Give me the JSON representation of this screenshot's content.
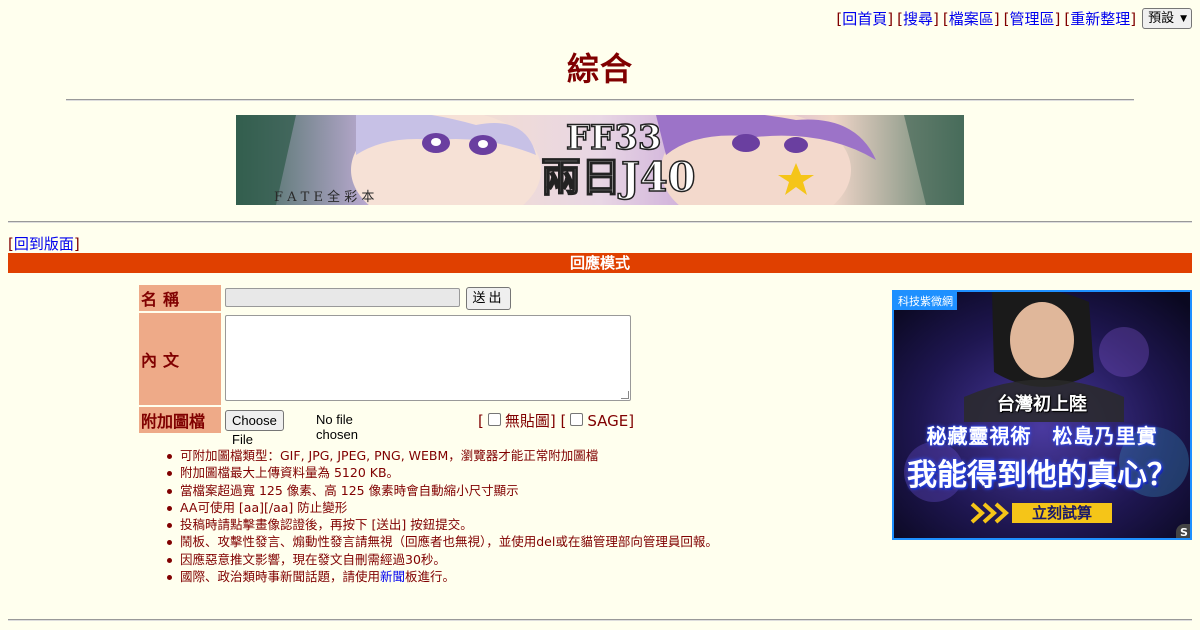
{
  "nav": {
    "items": [
      "回首頁",
      "搜尋",
      "檔案區",
      "管理區",
      "重新整理"
    ],
    "style_select": "預設"
  },
  "page_title": "綜合",
  "banner": {
    "text_main": "FF33",
    "text_sub": "兩日J40",
    "text_fate": "F A T E 全 彩 本"
  },
  "back_link": "回到版面",
  "reply_mode": "回應模式",
  "form": {
    "name_label": "名稱",
    "send_label": "送出",
    "body_label": "內文",
    "file_label": "附加圖檔",
    "choose_file": "Choose File",
    "no_file": "No file chosen",
    "no_image_label": "無貼圖",
    "sage_label": "SAGE"
  },
  "rules": [
    "可附加圖檔類型：GIF, JPG, JPEG, PNG, WEBM，瀏覽器才能正常附加圖檔",
    "附加圖檔最大上傳資料量為 5120 KB。",
    "當檔案超過寬 125 像素、高 125 像素時會自動縮小尺寸顯示",
    "AA可使用 [aa][/aa] 防止變形",
    "投稿時請點擊畫像認證後，再按下 [送出] 按鈕提交。",
    "鬧板、攻擊性發言、煽動性發言請無視（回應者也無視），並使用del或在貓管理部向管理員回報。",
    "因應惡意推文影響，現在發文自刪需經過30秒。"
  ],
  "rule_last": {
    "prefix": "國際、政治類時事新聞話題，請使用",
    "link": "新聞",
    "suffix": "板進行。"
  },
  "ad": {
    "tag": "科技紫微網",
    "line1": "台灣初上陸",
    "line2": "秘藏靈視術　松島乃里實",
    "line3": "我能得到他的真心？",
    "cta": "立刻試算",
    "badge": "S"
  },
  "colors": {
    "background": "#ffffee",
    "text": "#800000",
    "reply_bar": "#e04000",
    "label_bg": "#eeaa88",
    "ad_border": "#1e90ff"
  }
}
